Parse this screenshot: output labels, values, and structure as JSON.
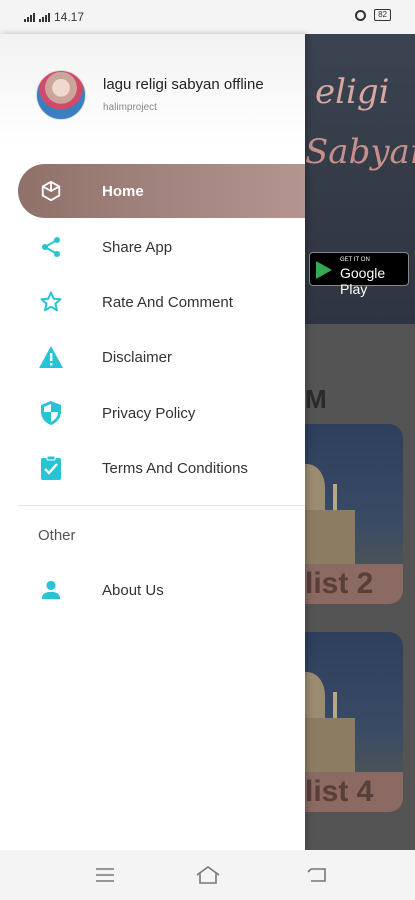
{
  "status_bar": {
    "time": "14.17",
    "battery": "82"
  },
  "background_app": {
    "hero_line1": "eligi",
    "hero_line2": "Sabyan",
    "badge_small": "GET IT ON",
    "badge_big": "Google Play",
    "section_letter": "M",
    "cards": [
      {
        "label": "list 2"
      },
      {
        "label": "list 4"
      }
    ]
  },
  "drawer": {
    "app_title": "lagu religi sabyan offline",
    "app_subtitle": "halimproject",
    "items": [
      {
        "label": "Home",
        "icon": "cube-icon",
        "active": true
      },
      {
        "label": "Share App",
        "icon": "share-icon"
      },
      {
        "label": "Rate And Comment",
        "icon": "star-icon"
      },
      {
        "label": "Disclaimer",
        "icon": "warning-icon"
      },
      {
        "label": "Privacy Policy",
        "icon": "shield-icon"
      },
      {
        "label": "Terms And Conditions",
        "icon": "clipboard-check-icon"
      }
    ],
    "other_section_label": "Other",
    "other_items": [
      {
        "label": "About Us",
        "icon": "person-icon"
      }
    ]
  },
  "colors": {
    "accent": "#29c4d4",
    "active_bg": "#a28580"
  },
  "nav_bar": {
    "buttons": [
      "menu-icon",
      "home-icon",
      "back-icon"
    ]
  }
}
